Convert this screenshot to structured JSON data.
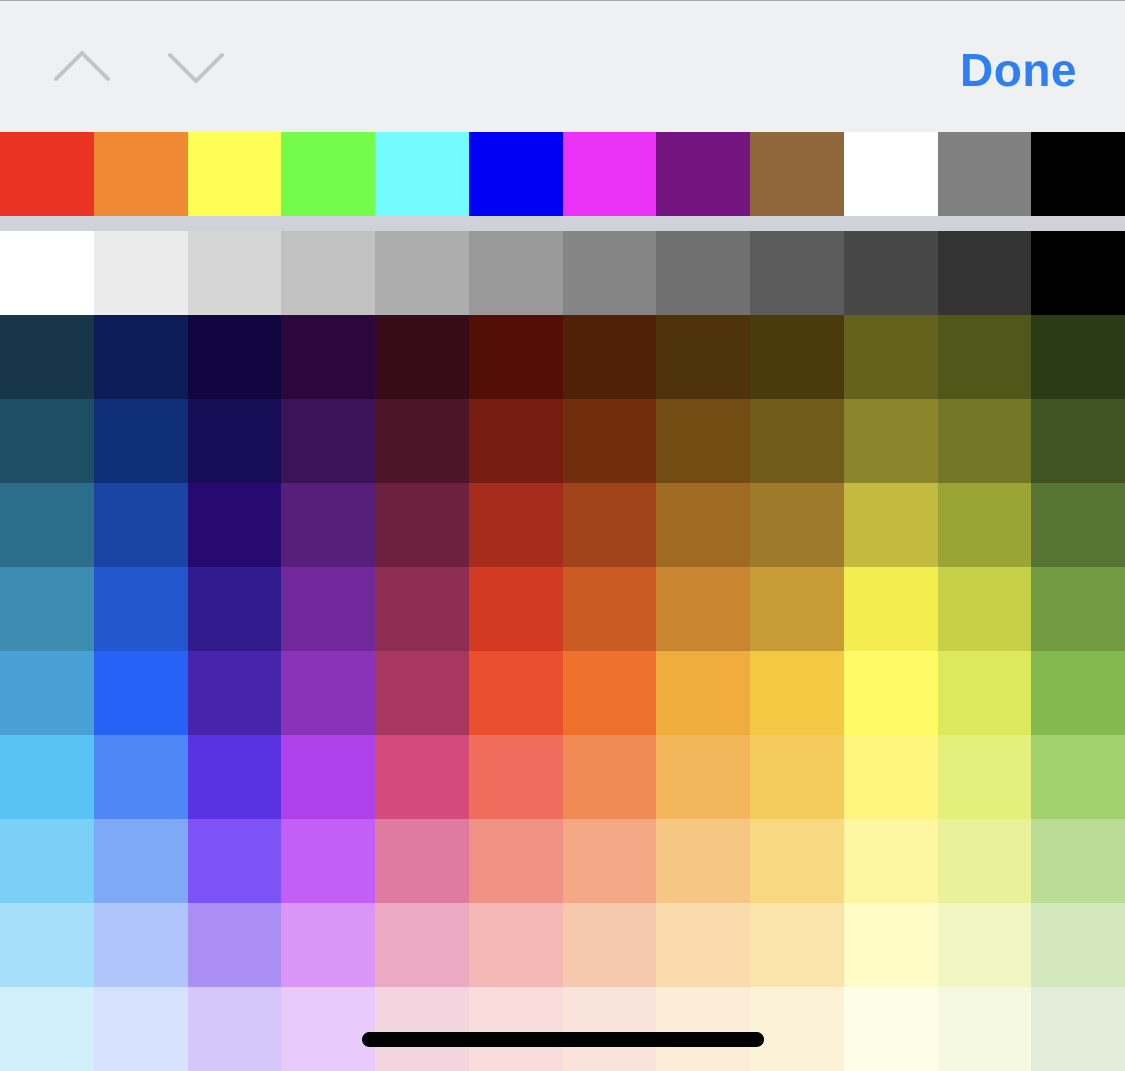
{
  "toolbar": {
    "done_label": "Done",
    "previous_icon": "chevron-up-icon",
    "next_icon": "chevron-down-icon",
    "accent_color": "#2f7ff0",
    "chevron_color": "#c4c4c6"
  },
  "basic_colors": [
    "#e93323",
    "#f08933",
    "#fffe54",
    "#75fb4c",
    "#74fbfd",
    "#0000f5",
    "#ea33f7",
    "#741480",
    "#8f673b",
    "#ffffff",
    "#808080",
    "#000000"
  ],
  "shade_rows": [
    [
      "#ffffff",
      "#ebebeb",
      "#d6d6d6",
      "#c2c2c2",
      "#adadad",
      "#999999",
      "#858585",
      "#707070",
      "#5c5c5c",
      "#474747",
      "#333333",
      "#000000"
    ],
    [
      "#17364a",
      "#0b1c56",
      "#11063f",
      "#2b073d",
      "#370b18",
      "#530f06",
      "#502007",
      "#4e3209",
      "#4b3a0b",
      "#63611b",
      "#515718",
      "#2b3b16"
    ],
    [
      "#1e4e63",
      "#0f2e7a",
      "#170d57",
      "#3c1356",
      "#4d1628",
      "#771c10",
      "#712d0e",
      "#734c14",
      "#715b1b",
      "#89862b",
      "#737627",
      "#3e5423"
    ],
    [
      "#2b6d8a",
      "#1a44a3",
      "#260a70",
      "#581f7a",
      "#6e213e",
      "#a72b1b",
      "#a1431a",
      "#9f6b23",
      "#9e7b2a",
      "#c3bb3f",
      "#9ba536",
      "#577534"
    ],
    [
      "#3c8db1",
      "#2456d0",
      "#321b8d",
      "#70289a",
      "#8c2d51",
      "#d23a22",
      "#c95b23",
      "#c98530",
      "#c89d37",
      "#f3ed4f",
      "#c6d147",
      "#739c42"
    ],
    [
      "#4a9fd4",
      "#2762f7",
      "#4624ac",
      "#8a32b8",
      "#a8375f",
      "#eb502e",
      "#ef712d",
      "#f1ac3e",
      "#f3c843",
      "#fefb66",
      "#dbe95a",
      "#84b94f"
    ],
    [
      "#5ac3f6",
      "#4f87f6",
      "#5932e3",
      "#af41eb",
      "#d54a7d",
      "#ee6d5d",
      "#f08b56",
      "#f3b65a",
      "#f5cb5d",
      "#fef47e",
      "#e5ef7b",
      "#a1d16d"
    ],
    [
      "#7ad0f6",
      "#7fa8f7",
      "#7d53f5",
      "#c25ff7",
      "#e07ba0",
      "#f09286",
      "#f4a886",
      "#f6c784",
      "#f8d982",
      "#fef7a2",
      "#ebf19b",
      "#bbdc95"
    ],
    [
      "#a5dff9",
      "#afc5fc",
      "#ac8ff4",
      "#d996f7",
      "#ebaac2",
      "#f6b8b4",
      "#f6c9af",
      "#f9dbae",
      "#fae4ab",
      "#fefbc7",
      "#f2f6c2",
      "#d4e8bd"
    ],
    [
      "#d2effc",
      "#d6e1fd",
      "#d5c7fa",
      "#e8cafb",
      "#f3d5e0",
      "#f9dcdc",
      "#fae3da",
      "#fcedd9",
      "#fcf2d7",
      "#fdfde8",
      "#f6f9e2",
      "#e2ecd8"
    ]
  ]
}
